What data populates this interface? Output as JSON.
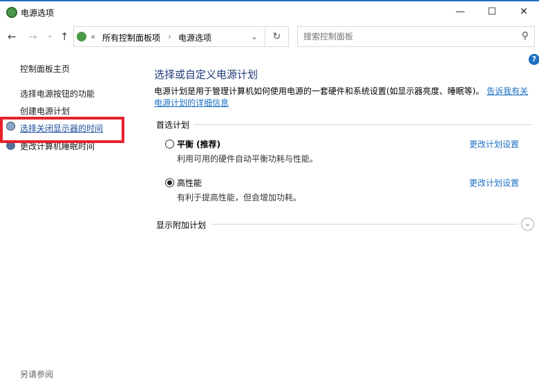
{
  "window": {
    "title": "电源选项",
    "minimize": "—",
    "maximize": "☐",
    "close": "✕"
  },
  "nav": {
    "back": "←",
    "forward": "→",
    "recent": "⌄",
    "up": "↑",
    "breadcrumb_prefix": "«",
    "crumbs": [
      "所有控制面板项",
      "电源选项"
    ],
    "separator": "›",
    "dropdown": "⌄",
    "refresh": "↻"
  },
  "search": {
    "placeholder": "搜索控制面板",
    "icon": "⚲"
  },
  "help": "?",
  "sidebar": {
    "home": "控制面板主页",
    "items": [
      "选择电源按钮的功能",
      "创建电源计划",
      "选择关闭显示器的时间",
      "更改计算机睡眠时间"
    ],
    "see_also": "另请参阅"
  },
  "main": {
    "title": "选择或自定义电源计划",
    "description": "电源计划是用于管理计算机如何使用电源的一套硬件和系统设置(如显示器亮度、睡眠等)。",
    "link": "告诉我有关电源计划的详细信息",
    "preferred": "首选计划",
    "plans": [
      {
        "name": "平衡 (推荐)",
        "desc": "利用可用的硬件自动平衡功耗与性能。",
        "selected": false,
        "change": "更改计划设置"
      },
      {
        "name": "高性能",
        "desc": "有利于提高性能，但会增加功耗。",
        "selected": true,
        "change": "更改计划设置"
      }
    ],
    "additional": "显示附加计划",
    "expand_icon": "⌄"
  }
}
